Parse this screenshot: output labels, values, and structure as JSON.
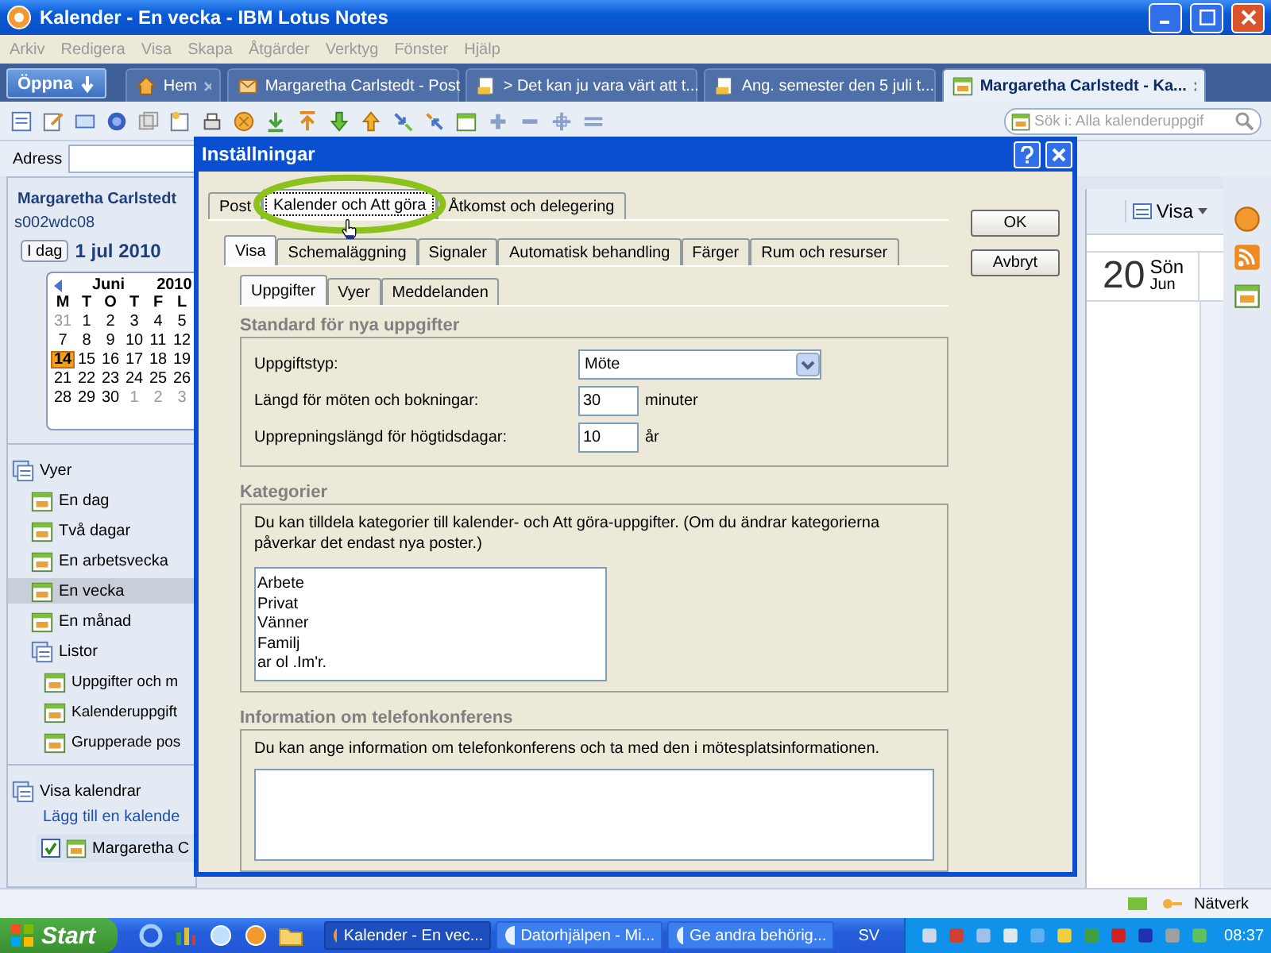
{
  "window": {
    "title": "Kalender - En vecka - IBM Lotus Notes"
  },
  "menu": [
    "Arkiv",
    "Redigera",
    "Visa",
    "Skapa",
    "Åtgärder",
    "Verktyg",
    "Fönster",
    "Hjälp"
  ],
  "open_button": "Öppna",
  "tabs": [
    {
      "label": "Hem",
      "selected": false,
      "kind": "home"
    },
    {
      "label": "Margaretha Carlstedt - Post",
      "selected": false,
      "kind": "mail"
    },
    {
      "label": "> Det kan ju vara värt att t...",
      "selected": false,
      "kind": "doc"
    },
    {
      "label": "Ang. semester den 5 juli t...",
      "selected": false,
      "kind": "doc"
    },
    {
      "label": "Margaretha Carlstedt - Ka...",
      "selected": true,
      "kind": "calendar"
    }
  ],
  "search": {
    "placeholder": "Sök i: Alla kalenderuppgif"
  },
  "address": {
    "label": "Adress"
  },
  "sidebar": {
    "owner": "Margaretha Carlstedt",
    "server": "s002wdc08",
    "today_button": "I dag",
    "date": "1 jul 2010",
    "mini_calendar": {
      "month": "Juni",
      "year": "2010",
      "weekdays": [
        "M",
        "T",
        "O",
        "T",
        "F",
        "L"
      ],
      "weeks": [
        [
          {
            "d": "31",
            "other": true,
            "selected": false
          },
          {
            "d": "1",
            "other": false,
            "selected": false
          },
          {
            "d": "2",
            "other": false,
            "selected": false
          },
          {
            "d": "3",
            "other": false,
            "selected": false
          },
          {
            "d": "4",
            "other": false,
            "selected": false
          },
          {
            "d": "5",
            "other": false,
            "selected": false
          }
        ],
        [
          {
            "d": "7",
            "other": false,
            "selected": false
          },
          {
            "d": "8",
            "other": false,
            "selected": false
          },
          {
            "d": "9",
            "other": false,
            "selected": false
          },
          {
            "d": "10",
            "other": false,
            "selected": false
          },
          {
            "d": "11",
            "other": false,
            "selected": false
          },
          {
            "d": "12",
            "other": false,
            "selected": false
          }
        ],
        [
          {
            "d": "14",
            "other": false,
            "selected": true
          },
          {
            "d": "15",
            "other": false,
            "selected": false
          },
          {
            "d": "16",
            "other": false,
            "selected": false
          },
          {
            "d": "17",
            "other": false,
            "selected": false
          },
          {
            "d": "18",
            "other": false,
            "selected": false
          },
          {
            "d": "19",
            "other": false,
            "selected": false
          }
        ],
        [
          {
            "d": "21",
            "other": false,
            "selected": false
          },
          {
            "d": "22",
            "other": false,
            "selected": false
          },
          {
            "d": "23",
            "other": false,
            "selected": false
          },
          {
            "d": "24",
            "other": false,
            "selected": false
          },
          {
            "d": "25",
            "other": false,
            "selected": false
          },
          {
            "d": "26",
            "other": false,
            "selected": false
          }
        ],
        [
          {
            "d": "28",
            "other": false,
            "selected": false
          },
          {
            "d": "29",
            "other": false,
            "selected": false
          },
          {
            "d": "30",
            "other": false,
            "selected": false
          },
          {
            "d": "1",
            "other": true,
            "selected": false
          },
          {
            "d": "2",
            "other": true,
            "selected": false
          },
          {
            "d": "3",
            "other": true,
            "selected": false
          }
        ]
      ]
    },
    "views": {
      "label": "Vyer",
      "children": [
        {
          "label": "En dag",
          "selected": false
        },
        {
          "label": "Två dagar",
          "selected": false
        },
        {
          "label": "En arbetsvecka",
          "selected": false
        },
        {
          "label": "En vecka",
          "selected": true
        },
        {
          "label": "En månad",
          "selected": false
        },
        {
          "label": "Listor",
          "selected": false,
          "children": [
            {
              "label": "Uppgifter och m",
              "selected": false
            },
            {
              "label": "Kalenderuppgift",
              "selected": false
            },
            {
              "label": "Grupperade pos",
              "selected": false
            }
          ]
        }
      ]
    },
    "calendars": {
      "label": "Visa kalendrar",
      "link": "Lägg till en kalende",
      "items": [
        {
          "label": "Margaretha C",
          "checked": true
        }
      ]
    }
  },
  "calendar_pane": {
    "view_button": "Visa",
    "day": "20",
    "weekday": "Sön",
    "month": "Jun"
  },
  "dialog": {
    "title": "Inställningar",
    "tabs": [
      {
        "label": "Post",
        "selected": false
      },
      {
        "label": "Kalender och Att göra",
        "selected": true
      },
      {
        "label": "Åtkomst och delegering",
        "selected": false
      }
    ],
    "subtabs": [
      {
        "label": "Visa",
        "selected": true
      },
      {
        "label": "Schemaläggning",
        "selected": false
      },
      {
        "label": "Signaler",
        "selected": false
      },
      {
        "label": "Automatisk behandling",
        "selected": false
      },
      {
        "label": "Färger",
        "selected": false
      },
      {
        "label": "Rum och resurser",
        "selected": false
      }
    ],
    "subsubtabs": [
      {
        "label": "Uppgifter",
        "selected": true
      },
      {
        "label": "Vyer",
        "selected": false
      },
      {
        "label": "Meddelanden",
        "selected": false
      }
    ],
    "defaults": {
      "title": "Standard för nya uppgifter",
      "rows": [
        {
          "kind": "select",
          "label": "Uppgiftstyp:",
          "value": "Möte"
        },
        {
          "kind": "number",
          "label": "Längd för möten och bokningar:",
          "value": "30",
          "unit": "minuter"
        },
        {
          "kind": "number",
          "label": "Upprepningslängd för högtidsdagar:",
          "value": "10",
          "unit": "år"
        }
      ]
    },
    "categories": {
      "title": "Kategorier",
      "description": "Du kan tilldela kategorier till kalender- och Att göra-uppgifter.  (Om du ändrar kategorierna påverkar det endast nya poster.)",
      "items": [
        "Arbete",
        "Privat",
        "Vänner",
        "Familj",
        "ar ol .Im'r."
      ]
    },
    "conference": {
      "title": "Information om telefonkonferens",
      "description": "Du kan ange information om telefonkonferens och ta med den i mötesplatsinformationen."
    },
    "buttons": [
      "OK",
      "Avbryt"
    ]
  },
  "status_bar": {
    "network": "Nätverk"
  },
  "taskbar": {
    "start": "Start",
    "items": [
      {
        "label": "Kalender - En vec...",
        "selected": true
      },
      {
        "label": "Datorhjälpen - Mi...",
        "selected": false
      },
      {
        "label": "Ge andra behörig...",
        "selected": false
      }
    ],
    "language": "SV",
    "clock": "08:37"
  }
}
